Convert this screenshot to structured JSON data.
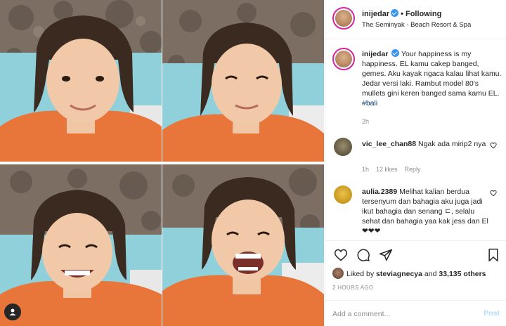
{
  "post": {
    "username": "inijedar",
    "follow_status": "Following",
    "location": "The Seminyak - Beach Resort & Spa",
    "caption": {
      "username": "inijedar",
      "text": "Your happiness is my happiness. EL kamu cakep banged, gemes. Aku kayak ngaca kalau lihat kamu. Jedar versi laki. Rambut model 80's mullets gini keren banged sama kamu EL.",
      "hashtag": "#bali",
      "time": "2h"
    },
    "comments": [
      {
        "username": "vic_lee_chan88",
        "text": "Ngak ada mirip2 nya",
        "time": "1h",
        "likes": "12 likes",
        "reply": "Reply"
      },
      {
        "username": "aulia.2389",
        "text": "Melihat kalian berdua tersenyum dan bahagia aku juga jadi ikut bahagia dan senang ㄷ, selalu sehat dan bahagia yaa kak jess dan El ❤❤❤"
      }
    ],
    "likes": {
      "prefix": "Liked by",
      "user": "steviagnecya",
      "joiner": "and",
      "count": "33,135 others"
    },
    "timestamp": "2 HOURS AGO",
    "add_comment_placeholder": "Add a comment...",
    "post_label": "Post"
  },
  "icons": [
    "verified-badge-icon",
    "heart-icon",
    "comment-icon",
    "share-icon",
    "bookmark-icon",
    "user-tag-icon"
  ],
  "colors": {
    "verified": "#3897f0",
    "hashtag": "#00376b",
    "muted": "#8e8e8e",
    "post_disabled": "#b2dffc",
    "shirt": "#e8763a",
    "sofa": "#8fd0db"
  }
}
